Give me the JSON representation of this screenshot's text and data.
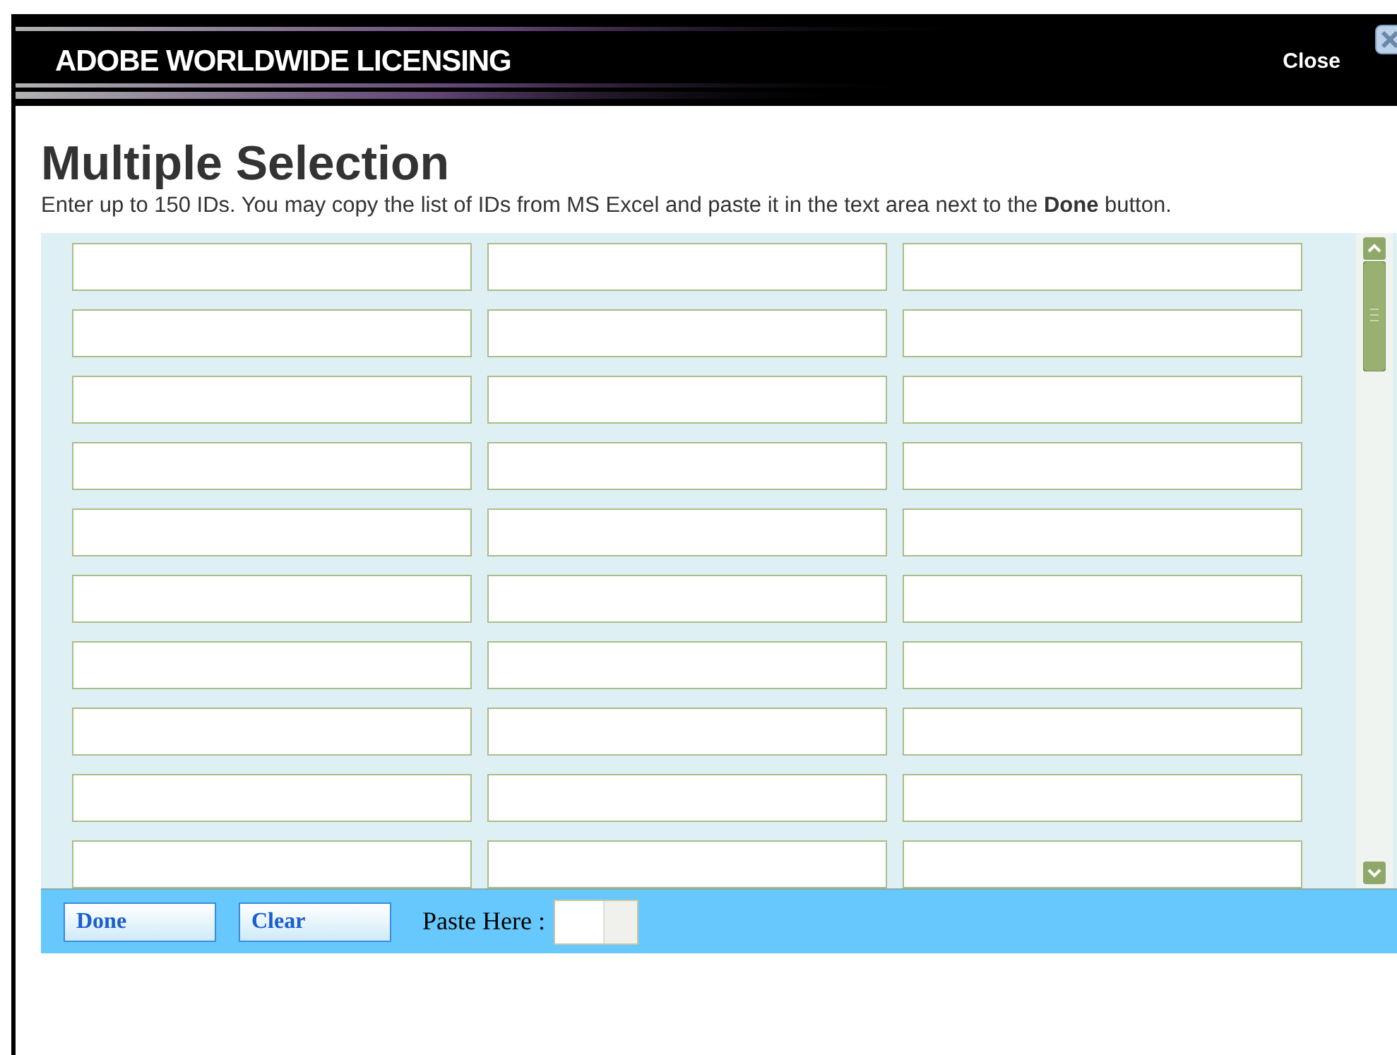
{
  "header": {
    "brand": "ADOBE WORLDWIDE LICENSING",
    "close_label": "Close"
  },
  "title": "Multiple Selection",
  "instructions": "Enter up to 150 IDs. You may copy the list of IDs from MS Excel and paste it in the text area next to the **Done** button.",
  "id_grid": {
    "rows": [
      [
        {
          "kind": "input"
        },
        {
          "kind": "input"
        },
        {
          "kind": "input"
        }
      ],
      [
        {
          "kind": "input"
        },
        {
          "kind": "input"
        },
        {
          "kind": "input"
        }
      ],
      [
        {
          "kind": "input"
        },
        {
          "kind": "input"
        },
        {
          "kind": "input"
        }
      ],
      [
        {
          "kind": "input"
        },
        {
          "kind": "input"
        },
        {
          "kind": "input"
        }
      ],
      [
        {
          "kind": "input"
        },
        {
          "kind": "input"
        },
        {
          "kind": "input"
        }
      ],
      [
        {
          "kind": "input"
        },
        {
          "kind": "input"
        },
        {
          "kind": "input"
        }
      ],
      [
        {
          "kind": "input"
        },
        {
          "kind": "input"
        },
        {
          "kind": "input"
        }
      ],
      [
        {
          "kind": "input"
        },
        {
          "kind": "input"
        },
        {
          "kind": "input"
        }
      ],
      [
        {
          "kind": "input"
        },
        {
          "kind": "input"
        },
        {
          "kind": "input"
        }
      ],
      [
        {
          "kind": "input"
        },
        {
          "kind": "input"
        },
        {
          "kind": "input"
        }
      ]
    ]
  },
  "footer": {
    "buttons": [
      "Done",
      "Clear"
    ],
    "paste_label": "Paste Here :"
  }
}
